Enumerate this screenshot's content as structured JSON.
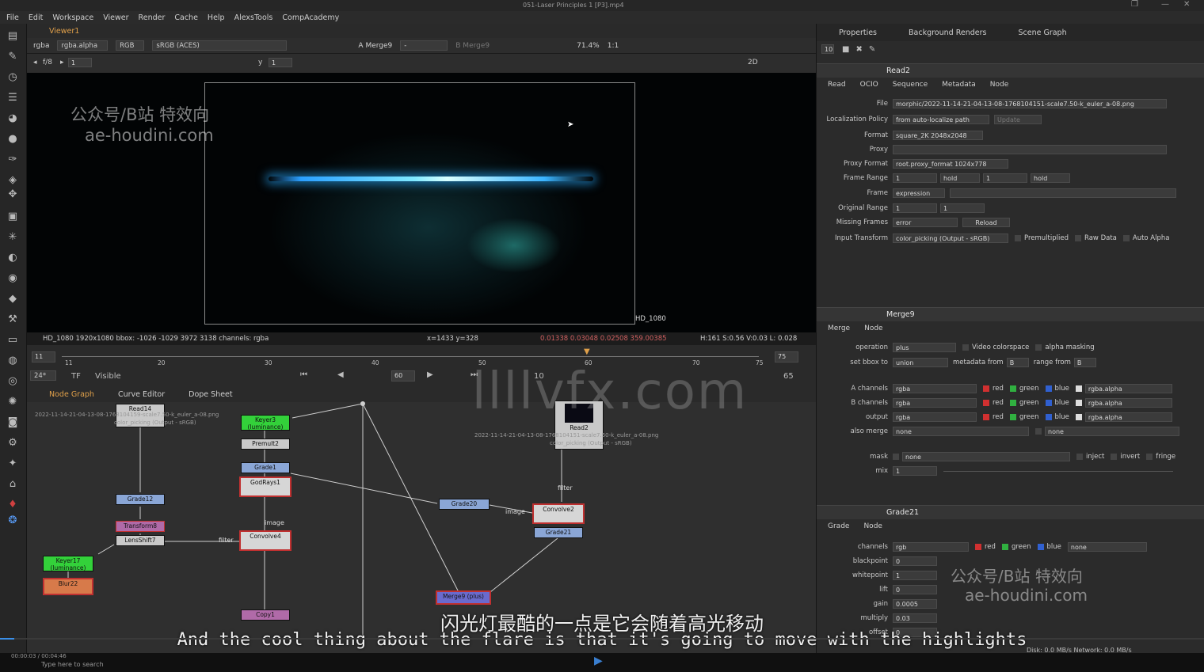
{
  "window": {
    "title": "051-Laser Principles 1 [P3].mp4"
  },
  "menu": [
    "File",
    "Edit",
    "Workspace",
    "Viewer",
    "Render",
    "Cache",
    "Help",
    "AlexsTools",
    "CompAcademy"
  ],
  "viewer": {
    "tab": "Viewer1",
    "channels": "rgba",
    "alpha": "rgba.alpha",
    "mode": "RGB",
    "colorspace": "sRGB (ACES)",
    "inputA": "A  Merge9",
    "inputB": "B  Merge9",
    "fstop": "f/8",
    "frame_field": "1",
    "y_field": "1",
    "zoom": "71.4%",
    "ratio": "1:1",
    "view": "2D",
    "format_label": "HD_1080",
    "status_left": "HD_1080 1920x1080  bbox: -1026 -1029 3972 3138 channels: rgba",
    "status_coords": "x=1433 y=328",
    "status_values": "0.01338  0.03048  0.02508  359.00385",
    "status_right": "H:161 S:0.56 V:0.03  L: 0.028",
    "watermark_line1": "公众号/B站 特效向",
    "watermark_line2": "ae-houdini.com"
  },
  "timeline": {
    "start": "11",
    "end": "75",
    "current": "60",
    "fps": "24*",
    "tf": "TF",
    "visible": "Visible",
    "inc": "10",
    "last": "65",
    "ticks": [
      "11",
      "20",
      "30",
      "40",
      "50",
      "60",
      "70",
      "75"
    ]
  },
  "nodegraph": {
    "tabs": [
      "Node Graph",
      "Curve Editor",
      "Dope Sheet"
    ],
    "nodes": [
      {
        "name": "Read14",
        "color": "#c9c9c9"
      },
      {
        "name": "Grade12",
        "color": "#8aa6d6"
      },
      {
        "name": "Transform8",
        "color": "#b06aa8"
      },
      {
        "name": "LensShift7",
        "color": "#c9c9c9"
      },
      {
        "name": "Keyer17 (luminance)",
        "color": "#33d13a"
      },
      {
        "name": "Blur22",
        "color": "#d77a4a"
      },
      {
        "name": "Keyer3 (luminance)",
        "color": "#33d13a"
      },
      {
        "name": "Premult2",
        "color": "#c9c9c9"
      },
      {
        "name": "Grade1",
        "color": "#8aa6d6"
      },
      {
        "name": "GodRays1",
        "color": "#d6d6d6"
      },
      {
        "name": "Convolve4",
        "color": "#d6d6d6"
      },
      {
        "name": "Copy1",
        "color": "#b06aa8"
      },
      {
        "name": "Grade20",
        "color": "#8aa6d6"
      },
      {
        "name": "Read2",
        "color": "#c9c9c9"
      },
      {
        "name": "Convolve2",
        "color": "#d6d6d6"
      },
      {
        "name": "Grade21",
        "color": "#8aa6d6"
      },
      {
        "name": "Merge9 (plus)",
        "color": "#6a6acd"
      }
    ],
    "labels": {
      "image1": "image",
      "filter1": "filter",
      "image2": "image",
      "filter2": "filter"
    },
    "read14_caption": "2022-11-14-21-04-13-08-1768104159-scale7.50-k_euler_a-08.png",
    "read14_sub": "color_picking (Output - sRGB)",
    "read2_caption": "2022-11-14-21-04-13-08-1768104151-scale7.50-k_euler_a-08.png",
    "read2_sub": "color_picking (Output - sRGB)"
  },
  "properties": {
    "tabs": [
      "Properties",
      "Background Renders",
      "Scene Graph"
    ],
    "max_panels": "10",
    "read": {
      "name": "Read2",
      "subtabs": [
        "Read",
        "OCIO",
        "Sequence",
        "Metadata",
        "Node"
      ],
      "file": "morphic/2022-11-14-21-04-13-08-1768104151-scale7.50-k_euler_a-08.png",
      "localization": "from auto-localize path",
      "update": "Update",
      "format": "square_2K 2048x2048",
      "proxy": "",
      "proxy_format": "root.proxy_format 1024x778",
      "frame_range_a": "1",
      "hold_a": "hold",
      "frame_range_b": "1",
      "hold_b": "hold",
      "frame": "expression",
      "orig_a": "1",
      "orig_b": "1",
      "missing": "error",
      "reload": "Reload",
      "input_transform": "color_picking (Output - sRGB)",
      "premultiplied": "Premultiplied",
      "raw": "Raw Data",
      "auto_alpha": "Auto Alpha",
      "labels": {
        "file": "File",
        "localization": "Localization Policy",
        "format": "Format",
        "proxy": "Proxy",
        "proxy_format": "Proxy Format",
        "frame_range": "Frame Range",
        "frame": "Frame",
        "original": "Original Range",
        "missing": "Missing Frames",
        "input": "Input Transform"
      }
    },
    "merge": {
      "name": "Merge9",
      "subtabs": [
        "Merge",
        "Node"
      ],
      "operation": "plus",
      "video_colorspace": "Video colorspace",
      "alpha_masking": "alpha masking",
      "bbox": "union",
      "metadata_from": "B",
      "range_from": "B",
      "a_channels": "rgba",
      "a_alpha": "rgba.alpha",
      "b_channels": "rgba",
      "b_alpha": "rgba.alpha",
      "output": "rgba",
      "out_alpha": "rgba.alpha",
      "also_merge": "none",
      "also_merge2": "none",
      "mask": "none",
      "inject": "inject",
      "invert": "invert",
      "fringe": "fringe",
      "mix": "1",
      "red": "red",
      "green": "green",
      "blue": "blue",
      "labels": {
        "operation": "operation",
        "bbox": "set bbox to",
        "metadata": "metadata from",
        "range": "range from",
        "a": "A channels",
        "b": "B channels",
        "output": "output",
        "also": "also merge",
        "mask": "mask",
        "mix": "mix"
      }
    },
    "grade": {
      "name": "Grade21",
      "subtabs": [
        "Grade",
        "Node"
      ],
      "channels": "rgb",
      "alpha_ch": "none",
      "blackpoint": "0",
      "whitepoint": "1",
      "lift": "0",
      "gain": "0.0005",
      "multiply": "0.03",
      "offset": "0",
      "labels": {
        "channels": "channels",
        "blackpoint": "blackpoint",
        "whitepoint": "whitepoint",
        "lift": "lift",
        "gain": "gain",
        "multiply": "multiply",
        "offset": "offset"
      },
      "watermark_line1": "公众号/B站 特效向",
      "watermark_line2": "ae-houdini.com"
    }
  },
  "subtitles": {
    "cn": "闪光灯最酷的一点是它会随着高光移动",
    "en": "And the cool thing about the flare is that it's going to move with the highlights"
  },
  "watermark_center": "llllvfx.com",
  "taskbar": {
    "search": "Type here to search",
    "time": "00:00:03 / 00:04:46",
    "disk": "Disk: 0.0 MB/s  Network: 0.0 MB/s"
  },
  "colors": {
    "accent": "#e0a04a",
    "selected_tab": "#e0a04a",
    "bg": "#1e1e1e"
  }
}
